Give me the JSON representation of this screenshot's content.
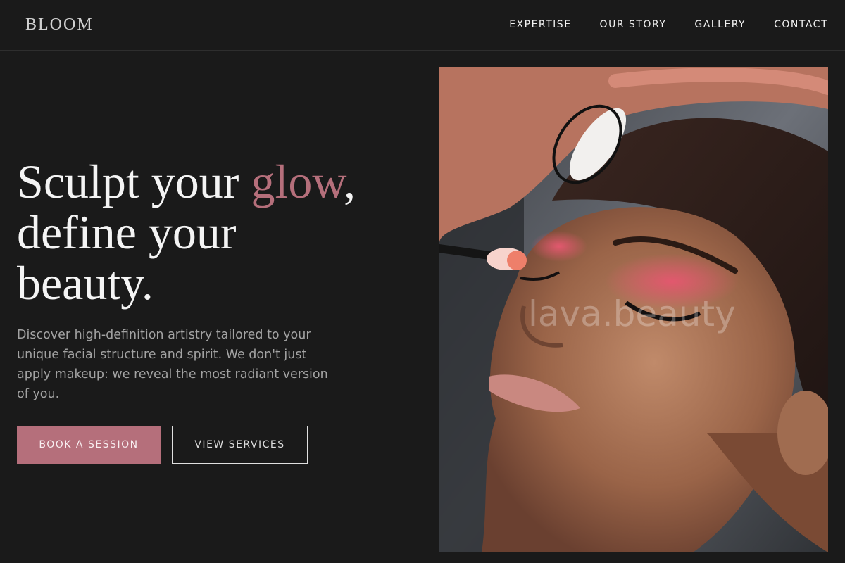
{
  "brand": {
    "logo": "BLOOM"
  },
  "nav": {
    "items": [
      "EXPERTISE",
      "OUR STORY",
      "GALLERY",
      "CONTACT"
    ]
  },
  "hero": {
    "headline_part1": "Sculpt your ",
    "headline_accent": "glow",
    "headline_part2": ",",
    "headline_line2": "define your",
    "headline_line3": "beauty.",
    "description": "Discover high-definition artistry tailored to your unique facial structure and spirit. We don't just apply makeup: we reveal the most radiant version of you.",
    "primary_cta": "BOOK A SESSION",
    "secondary_cta": "VIEW SERVICES",
    "image_watermark": "lava.beauty"
  },
  "colors": {
    "background": "#1a1a1a",
    "accent": "#b56f7b",
    "text": "#f4f4f4",
    "muted_text": "#a3a3a3"
  }
}
